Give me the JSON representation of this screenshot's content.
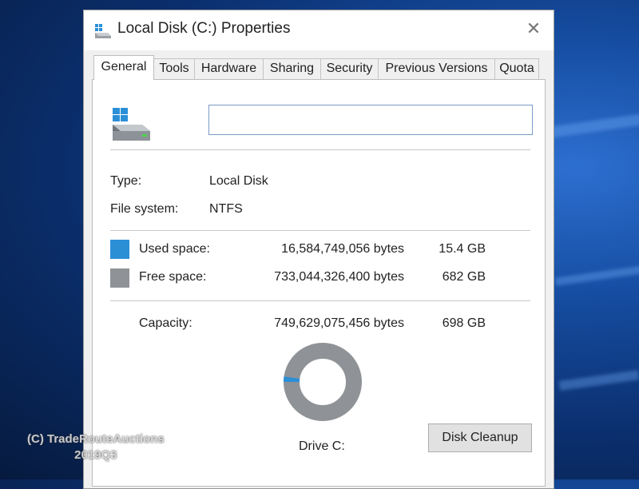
{
  "window": {
    "title": "Local Disk (C:) Properties"
  },
  "tabs": [
    {
      "label": "General"
    },
    {
      "label": "Tools"
    },
    {
      "label": "Hardware"
    },
    {
      "label": "Sharing"
    },
    {
      "label": "Security"
    },
    {
      "label": "Previous Versions"
    },
    {
      "label": "Quota"
    }
  ],
  "general": {
    "name_value": "",
    "type_label": "Type:",
    "type_value": "Local Disk",
    "fs_label": "File system:",
    "fs_value": "NTFS",
    "used": {
      "label": "Used space:",
      "bytes": "16,584,749,056 bytes",
      "size": "15.4 GB",
      "color": "#2b8fd6"
    },
    "free": {
      "label": "Free space:",
      "bytes": "733,044,326,400 bytes",
      "size": "682 GB",
      "color": "#8f9296"
    },
    "capacity": {
      "label": "Capacity:",
      "bytes": "749,629,075,456 bytes",
      "size": "698 GB"
    },
    "used_fraction": 0.022,
    "drive_label": "Drive C:",
    "cleanup_label": "Disk Cleanup"
  },
  "watermark": {
    "line1": "(C) TradeRouteAuctions",
    "line2": "2019Q3"
  }
}
